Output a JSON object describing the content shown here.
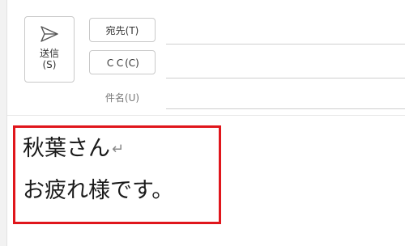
{
  "compose": {
    "send_button": {
      "icon": "send-icon",
      "label": "送信",
      "shortcut": "(S)"
    },
    "to_button_label": "宛先(T)",
    "cc_button_label": "ＣＣ(C)",
    "subject_label": "件名(U)",
    "to_value": "",
    "cc_value": "",
    "subject_value": ""
  },
  "body": {
    "line_1": "秋葉さん",
    "line_1_mark": "↵",
    "line_2": "お疲れ様です。",
    "highlight_color": "#e0161c"
  }
}
